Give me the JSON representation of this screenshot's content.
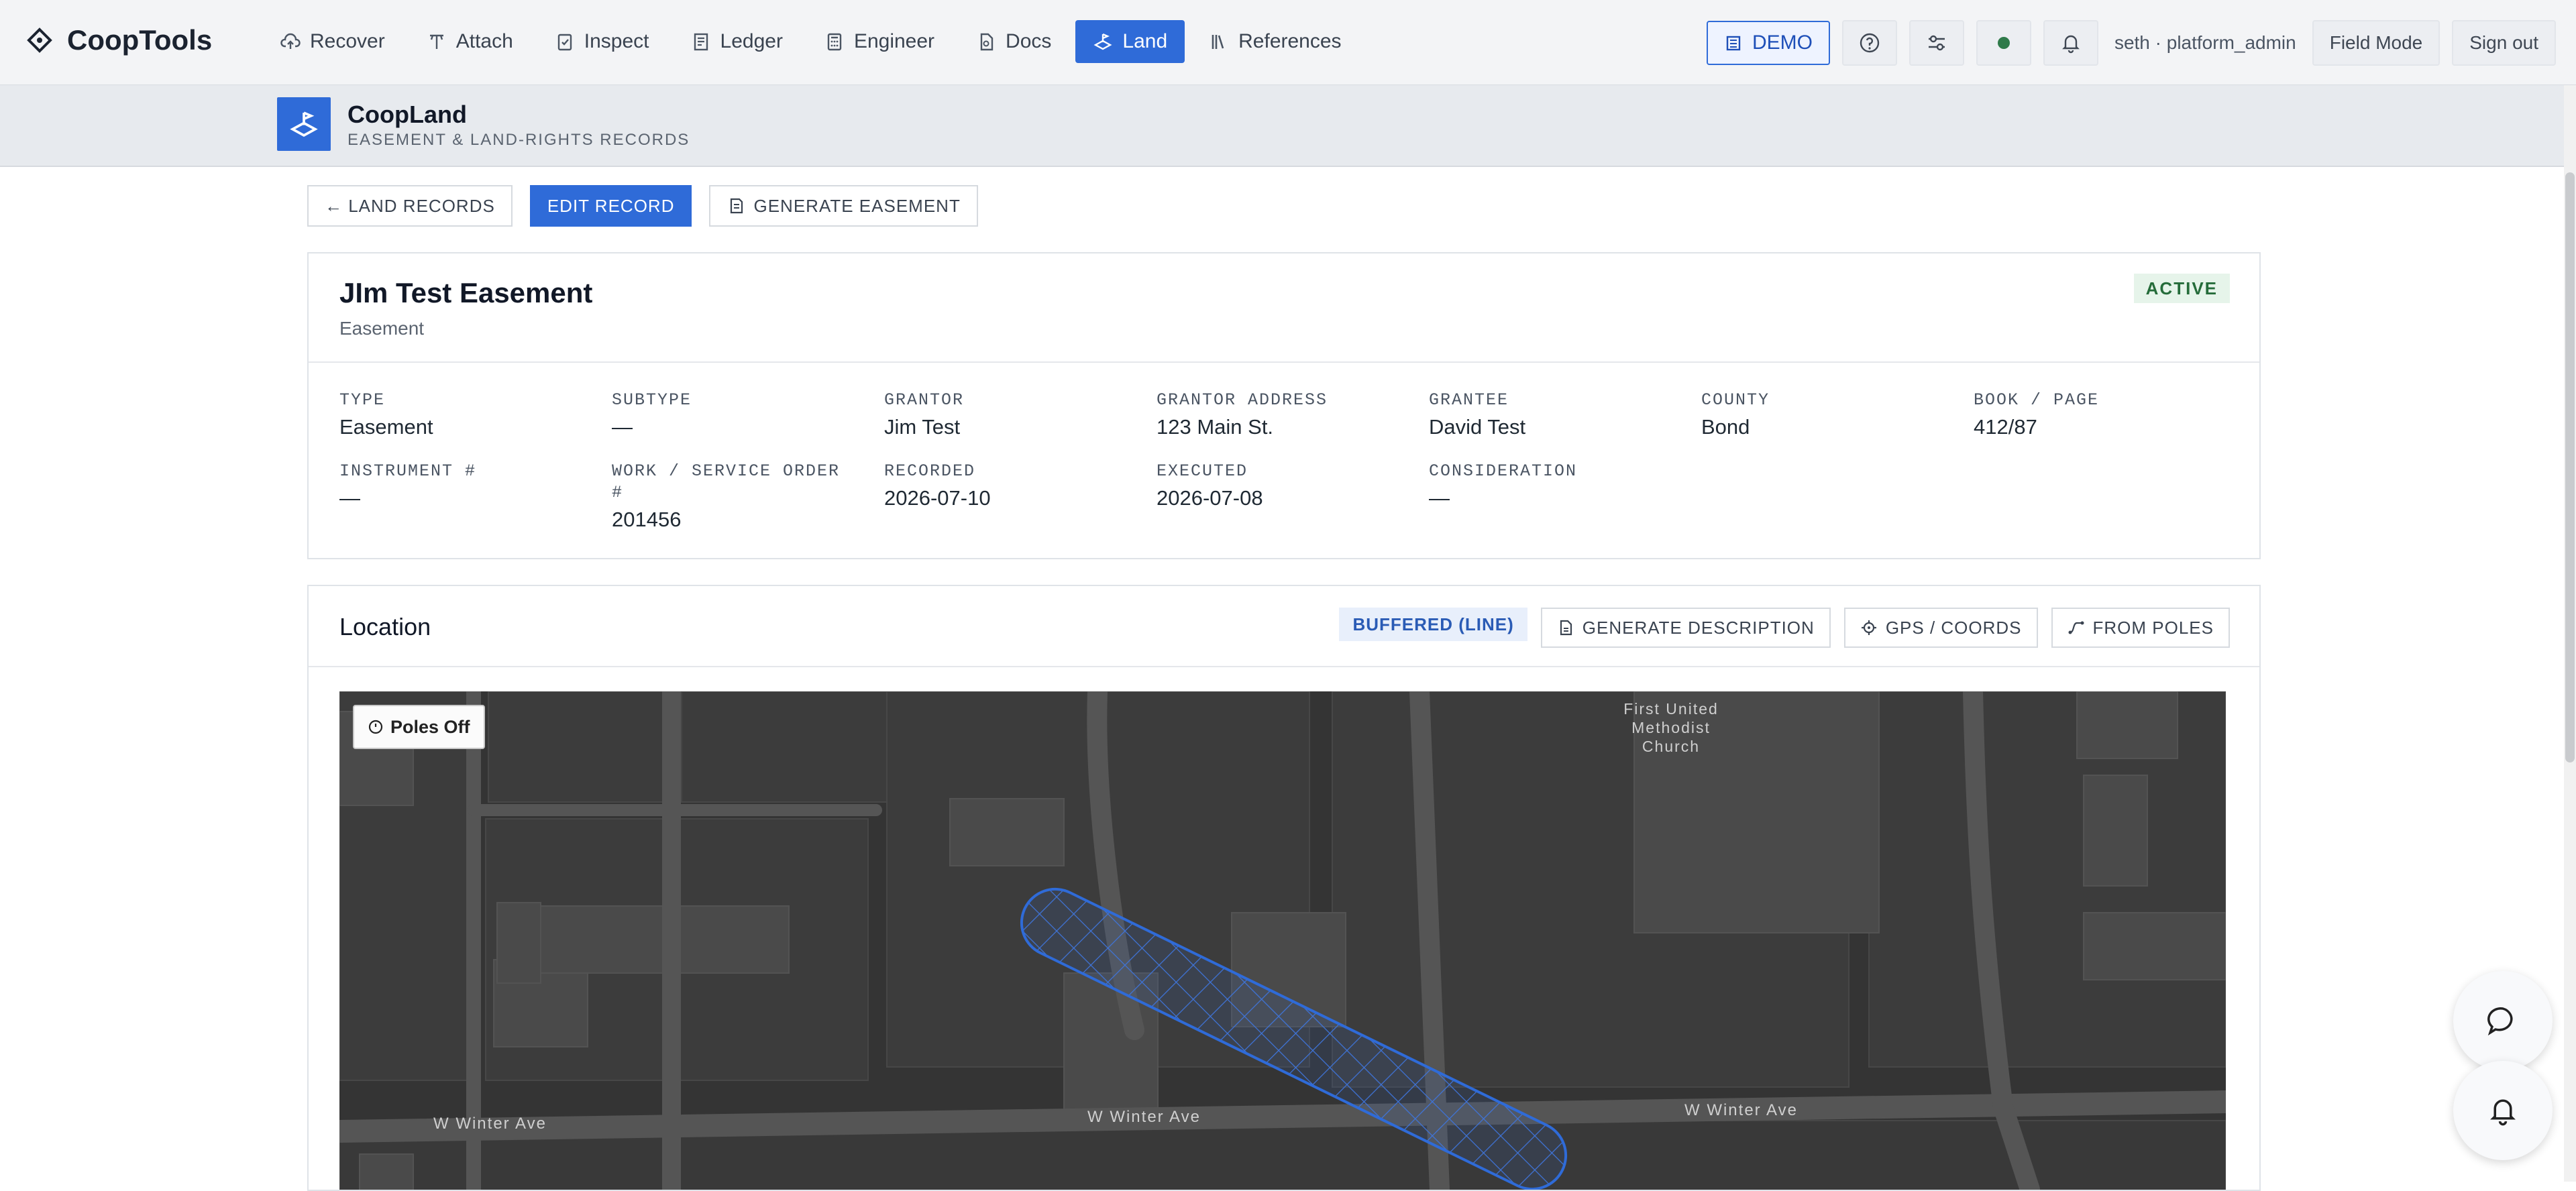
{
  "app": {
    "name": "CoopTools",
    "nav": [
      {
        "label": "Recover",
        "icon": "cloud-upload-icon"
      },
      {
        "label": "Attach",
        "icon": "wrench-icon"
      },
      {
        "label": "Inspect",
        "icon": "clipboard-icon"
      },
      {
        "label": "Ledger",
        "icon": "ledger-icon"
      },
      {
        "label": "Engineer",
        "icon": "calculator-icon"
      },
      {
        "label": "Docs",
        "icon": "document-icon"
      },
      {
        "label": "Land",
        "icon": "land-icon",
        "active": true
      },
      {
        "label": "References",
        "icon": "books-icon"
      }
    ],
    "demo_label": "DEMO",
    "user": "seth · platform_admin",
    "field_mode": "Field Mode",
    "sign_out": "Sign out"
  },
  "subheader": {
    "title": "CoopLand",
    "subtitle": "EASEMENT & LAND-RIGHTS RECORDS"
  },
  "actions": {
    "back": "← LAND RECORDS",
    "edit": "EDIT RECORD",
    "generate": "GENERATE EASEMENT"
  },
  "record": {
    "name": "JIm Test Easement",
    "kind": "Easement",
    "status": "ACTIVE",
    "fields": [
      {
        "label": "TYPE",
        "value": "Easement"
      },
      {
        "label": "SUBTYPE",
        "value": "—"
      },
      {
        "label": "GRANTOR",
        "value": "Jim Test"
      },
      {
        "label": "GRANTOR ADDRESS",
        "value": "123 Main St."
      },
      {
        "label": "GRANTEE",
        "value": "David Test"
      },
      {
        "label": "COUNTY",
        "value": "Bond"
      },
      {
        "label": "BOOK / PAGE",
        "value": "412/87"
      },
      {
        "label": "INSTRUMENT #",
        "value": "—"
      },
      {
        "label": "WORK / SERVICE ORDER #",
        "value": "201456"
      },
      {
        "label": "RECORDED",
        "value": "2026-07-10"
      },
      {
        "label": "EXECUTED",
        "value": "2026-07-08"
      },
      {
        "label": "CONSIDERATION",
        "value": "—"
      }
    ]
  },
  "location": {
    "title": "Location",
    "geometry_badge": "BUFFERED (LINE)",
    "generate_description": "GENERATE DESCRIPTION",
    "gps": "GPS / COORDS",
    "from_poles": "FROM POLES"
  },
  "map": {
    "poles_toggle": "Poles Off",
    "labels": {
      "street_left": "W Winter Ave",
      "street_mid": "W Winter Ave",
      "street_right": "W Winter Ave",
      "church_line1": "First United",
      "church_line2": "Methodist",
      "church_line3": "Church"
    }
  },
  "colors": {
    "accent": "#2f6bd8",
    "map_bg": "#343434",
    "active_badge_bg": "#e6f4ea",
    "active_badge_text": "#256c3a"
  }
}
